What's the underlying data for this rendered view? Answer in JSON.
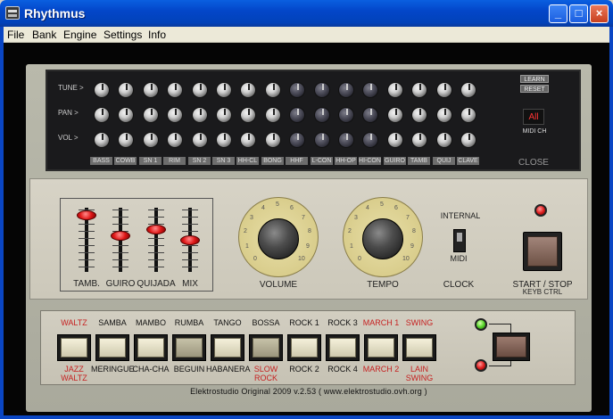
{
  "window": {
    "title": "Rhythmus",
    "controls": [
      "_",
      "□",
      "×"
    ]
  },
  "menu": [
    {
      "label": "File",
      "accel": "F"
    },
    {
      "label": "Bank",
      "accel": "B"
    },
    {
      "label": "Engine",
      "accel": "E"
    },
    {
      "label": "Settings",
      "accel": "S"
    },
    {
      "label": "Info",
      "accel": "I"
    }
  ],
  "mixer": {
    "row_labels": [
      "TUNE  >",
      "PAN  >",
      "VOL  >"
    ],
    "channels": [
      "BASS",
      "COWB",
      "SN 1",
      "RIM",
      "SN 2",
      "SN 3",
      "HH-CL",
      "BONG",
      "HHF",
      "L-CON",
      "HH-OP",
      "HI-CON",
      "GUIRO",
      "TAMB",
      "QUIJ",
      "CLAVE"
    ],
    "learn_label": "LEARN",
    "reset_label": "RESET",
    "midi_display": "All",
    "midi_label": "MIDI CH",
    "close_label": "CLOSE"
  },
  "faders": {
    "items": [
      {
        "label": "TAMB.",
        "level": 0.95
      },
      {
        "label": "GUIRO",
        "level": 0.6
      },
      {
        "label": "QUIJADA",
        "level": 0.7
      },
      {
        "label": "MIX",
        "level": 0.52
      }
    ]
  },
  "knobs": {
    "volume_label": "VOLUME",
    "tempo_label": "TEMPO",
    "scale": [
      "0",
      "1",
      "2",
      "3",
      "4",
      "5",
      "6",
      "7",
      "8",
      "9",
      "10"
    ]
  },
  "clock": {
    "internal_label": "INTERNAL",
    "midi_label": "MIDI",
    "clock_label": "CLOCK"
  },
  "start": {
    "label_line1": "START / STOP",
    "label_line2": "KEYB CTRL"
  },
  "rhythms": {
    "top_labels": [
      {
        "text": "WALTZ",
        "red": true
      },
      {
        "text": "SAMBA",
        "red": false
      },
      {
        "text": "MAMBO",
        "red": false
      },
      {
        "text": "RUMBA",
        "red": false
      },
      {
        "text": "TANGO",
        "red": false
      },
      {
        "text": "BOSSA",
        "red": false
      },
      {
        "text": "ROCK 1",
        "red": false
      },
      {
        "text": "ROCK 3",
        "red": false
      },
      {
        "text": "MARCH 1",
        "red": true
      },
      {
        "text": "SWING",
        "red": true
      }
    ],
    "bottom_labels": [
      {
        "line1": "JAZZ",
        "line2": "WALTZ",
        "red": true
      },
      {
        "line1": "MERINGUE",
        "line2": "",
        "red": false
      },
      {
        "line1": "CHA-CHA",
        "line2": "",
        "red": false
      },
      {
        "line1": "BEGUIN",
        "line2": "",
        "red": false
      },
      {
        "line1": "HABANERA",
        "line2": "",
        "red": false
      },
      {
        "line1": "SLOW",
        "line2": "ROCK",
        "red": true
      },
      {
        "line1": "ROCK 2",
        "line2": "",
        "red": false
      },
      {
        "line1": "ROCK 4",
        "line2": "",
        "red": false
      },
      {
        "line1": "MARCH 2",
        "line2": "",
        "red": true
      },
      {
        "line1": "LAIN",
        "line2": "SWING",
        "red": true
      }
    ],
    "pressed": [
      false,
      false,
      false,
      true,
      false,
      true,
      false,
      false,
      false,
      false
    ]
  },
  "footer": "Elektrostudio Original 2009  v.2.53  ( www.elektrostudio.ovh.org )"
}
